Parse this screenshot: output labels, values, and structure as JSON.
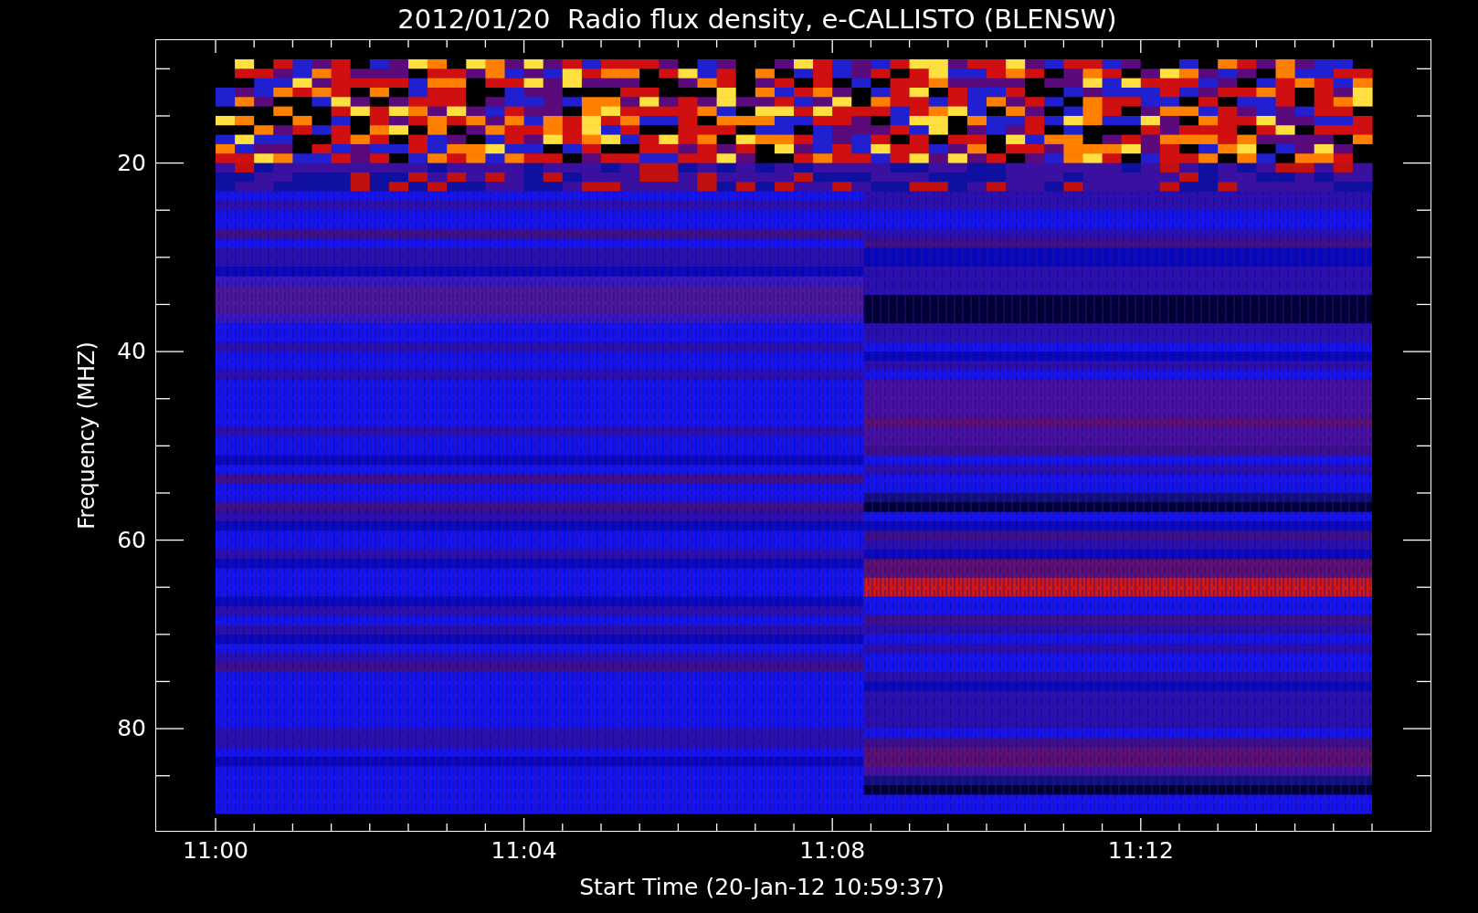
{
  "title": "2012/01/20  Radio flux density, e-CALLISTO (BLENSW)",
  "y_axis": {
    "label": "Frequency (MHZ)",
    "ticks": [
      "20",
      "40",
      "60",
      "80"
    ]
  },
  "x_axis": {
    "label": "Start Time (20-Jan-12 10:59:37)",
    "ticks": [
      "11:00",
      "11:04",
      "11:08",
      "11:12"
    ]
  }
}
